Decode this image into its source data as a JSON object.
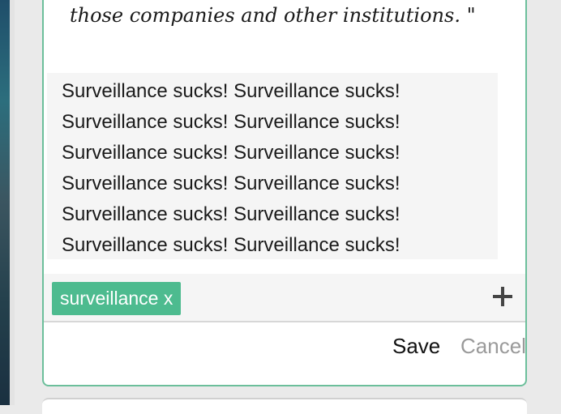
{
  "quote": {
    "text": "those companies and other institutions. \""
  },
  "note": {
    "lines": [
      "Surveillance sucks! Surveillance sucks!",
      "Surveillance sucks! Surveillance sucks!",
      "Surveillance sucks! Surveillance sucks!",
      "Surveillance sucks! Surveillance sucks!",
      "Surveillance sucks! Surveillance sucks!",
      "Surveillance sucks! Surveillance sucks!"
    ]
  },
  "tags": [
    {
      "label": "surveillance x"
    }
  ],
  "actions": {
    "save_label": "Save",
    "cancel_label": "Cancel"
  },
  "icons": {
    "add": "plus-icon"
  },
  "colors": {
    "card_border": "#6cbf9b",
    "tag_background": "#4dbb8f",
    "note_background": "#f5f5f5",
    "cancel_text": "#9a9a9a"
  }
}
